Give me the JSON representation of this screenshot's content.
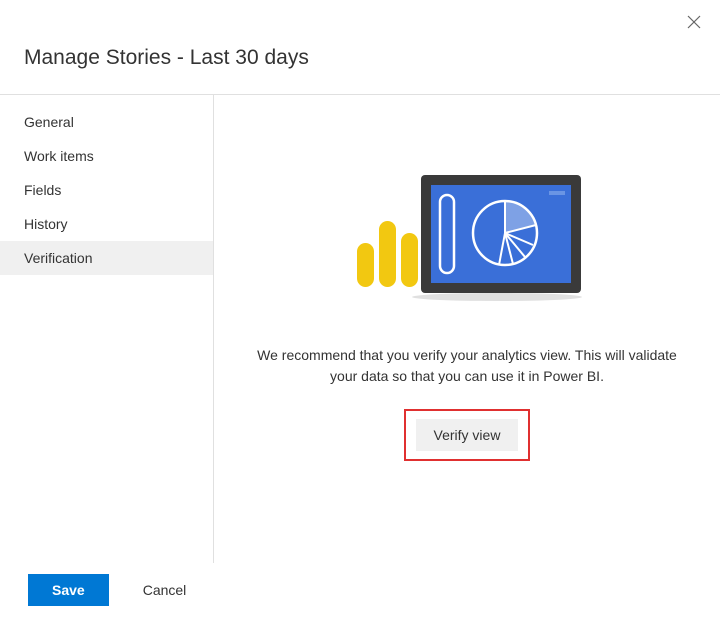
{
  "header": {
    "title": "Manage Stories - Last 30 days"
  },
  "sidebar": {
    "items": [
      {
        "label": "General"
      },
      {
        "label": "Work items"
      },
      {
        "label": "Fields"
      },
      {
        "label": "History"
      },
      {
        "label": "Verification"
      }
    ],
    "active_index": 4
  },
  "main": {
    "recommendation_text": "We recommend that you verify your analytics view. This will validate your data so that you can use it in Power BI.",
    "verify_button_label": "Verify view"
  },
  "footer": {
    "save_label": "Save",
    "cancel_label": "Cancel"
  },
  "icons": {
    "close": "close-icon",
    "illustration": "analytics-tablet-illustration"
  },
  "colors": {
    "primary": "#0078d4",
    "accent_yellow": "#f2c811",
    "accent_blue": "#3a6fd8",
    "highlight_border": "#e03030"
  }
}
